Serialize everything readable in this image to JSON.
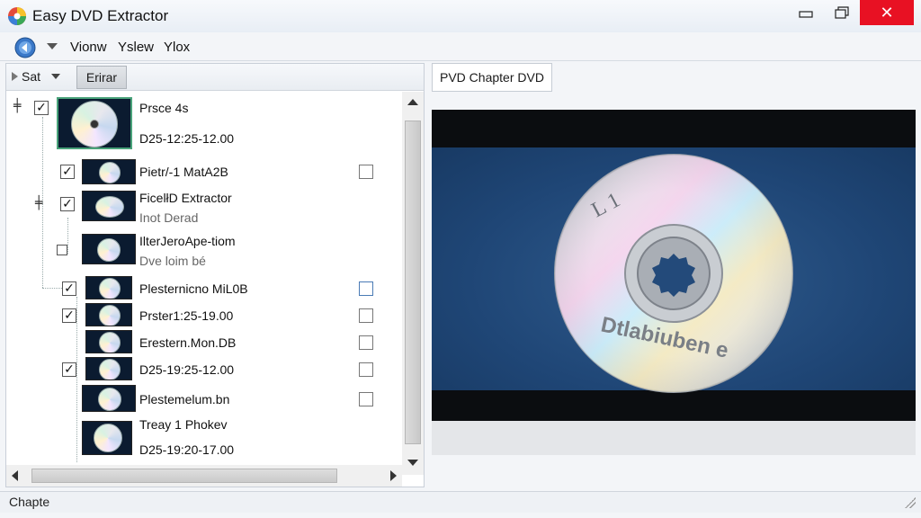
{
  "window": {
    "title": "Easy DVD Extractor"
  },
  "menubar": {
    "items": [
      "Vionw",
      "Yslew",
      "Ylox"
    ]
  },
  "left_toolbar": {
    "set_label": "Sat",
    "extract_label": "Erirar"
  },
  "tree": {
    "rows": [
      {
        "title": "Prsce 4s",
        "sub": "D25-12:25-12.00",
        "checked": true,
        "expander": "+",
        "right_cb": false
      },
      {
        "title": "Pietr/-1 MatA2B",
        "sub": "",
        "checked": true,
        "expander": "",
        "right_cb": true
      },
      {
        "title": "FicelłD Extractor",
        "sub": "Inot Derad",
        "checked": true,
        "expander": "+",
        "right_cb": false
      },
      {
        "title": "IlterJeroApe-tiom",
        "sub": "Dve loim bé",
        "checked": false,
        "expander": "",
        "right_cb": false
      },
      {
        "title": "Plesternicno MiL0B",
        "sub": "",
        "checked": true,
        "expander": "",
        "right_cb": true
      },
      {
        "title": "Prster1:25-19.00",
        "sub": "",
        "checked": true,
        "expander": "",
        "right_cb": true
      },
      {
        "title": "Erestern.Mon.DB",
        "sub": "",
        "checked": false,
        "expander": "",
        "right_cb": true
      },
      {
        "title": "D25-19:25-12.00",
        "sub": "",
        "checked": true,
        "expander": "",
        "right_cb": true
      },
      {
        "title": "Plestemelum.bn",
        "sub": "",
        "checked": false,
        "expander": "",
        "right_cb": true
      },
      {
        "title": "Treay 1 Phokev",
        "sub": "D25-19:20-17.00",
        "checked": false,
        "expander": "",
        "right_cb": false
      }
    ]
  },
  "right_pane": {
    "tab_label": "PVD Chapter DVD",
    "disc_top_text": "L 1",
    "disc_bottom_text": "Dtlabiuben e"
  },
  "status": {
    "text": "Chapte"
  },
  "icons": {
    "min": "minimize-icon",
    "max": "maximize-icon",
    "close": "close-icon"
  },
  "colors": {
    "close_red": "#e81123",
    "preview_blue": "#1f4676"
  }
}
